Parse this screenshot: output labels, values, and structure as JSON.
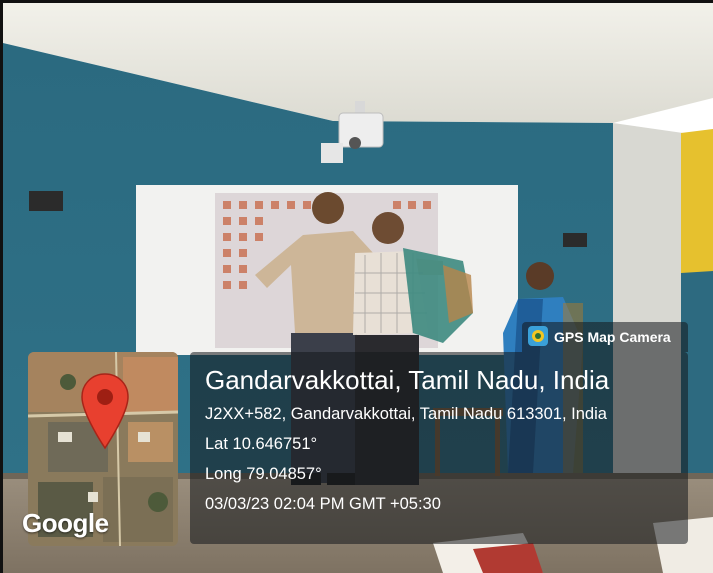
{
  "overlay": {
    "badge_label": "GPS Map Camera",
    "place": "Gandarvakkottai, Tamil Nadu, India",
    "address": "J2XX+582, Gandarvakkottai, Tamil Nadu 613301, India",
    "lat": "Lat 10.646751°",
    "long": "Long 79.04857°",
    "datetime": "03/03/23 02:04 PM GMT +05:30",
    "map_brand": "Google"
  },
  "icons": {
    "badge": "camera-app-icon",
    "marker": "map-pin-icon"
  },
  "colors": {
    "wall": "#2f6d83",
    "ceiling": "#e9e8df",
    "pin": "#e8402f",
    "accent_yellow": "#f0c419"
  }
}
